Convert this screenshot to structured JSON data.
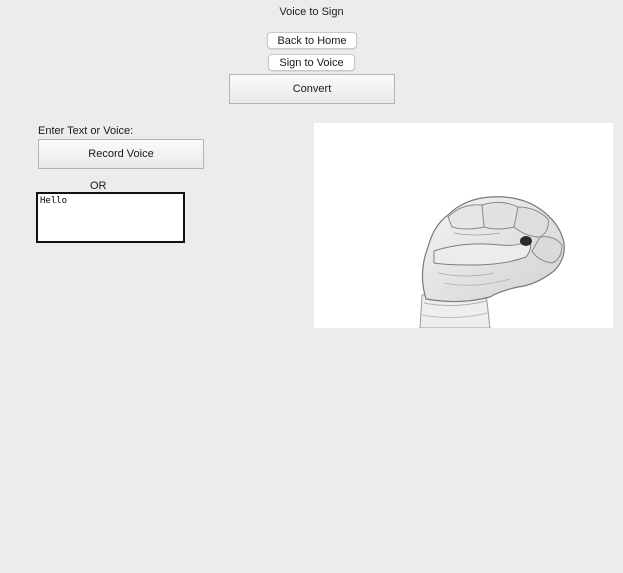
{
  "window": {
    "title": "Voice to Sign"
  },
  "buttons": {
    "back_home": "Back to Home",
    "sign_to_voice": "Sign to Voice",
    "convert": "Convert",
    "record_voice": "Record Voice"
  },
  "input_panel": {
    "prompt_label": "Enter Text or Voice:",
    "or_label": "OR",
    "text_value": "Hello"
  },
  "sign_display": {
    "image_subject": "hand-sign-fist-icon"
  }
}
